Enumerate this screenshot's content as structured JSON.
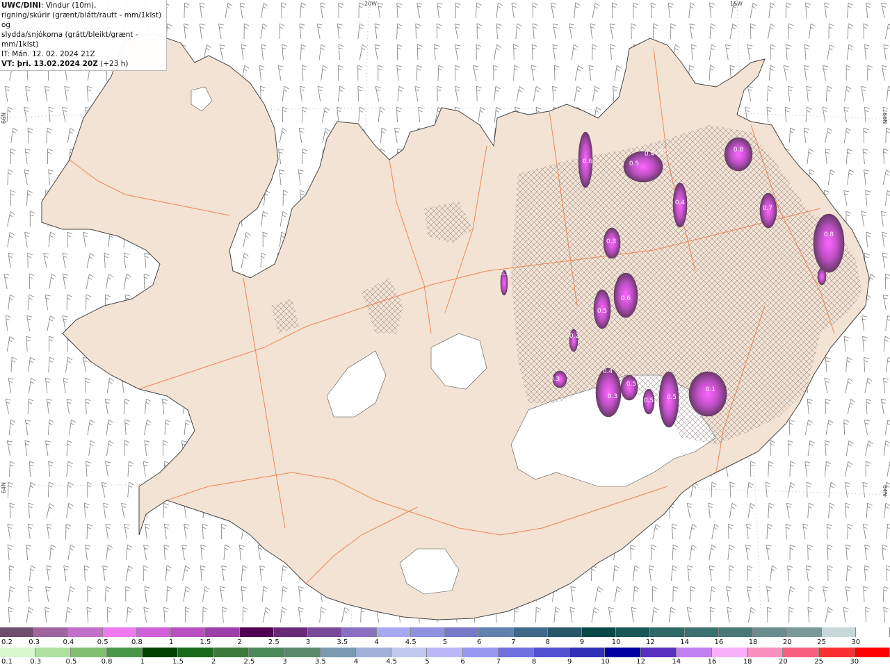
{
  "title": {
    "line1_bold": "UWC/DINI",
    "line1_rest": ": Vindur (10m),",
    "line2": "rigning/skúrir (grænt/blátt/rautt - mm/1klst) og",
    "line3": "slydda/snjókoma (grátt/bleikt/grænt - mm/1klst)",
    "line4": "IT: Mán. 12. 02. 2024 21Z",
    "line5_bold": "VT: þri. 13.02.2024 20Z",
    "line5_rest": " (+23 h)"
  },
  "grid_labels": {
    "lon_20w": "20W",
    "lon_15w": "15W",
    "lat_66n_left": "66N",
    "lat_66n_right": "66N",
    "lat_64n_left": "64N",
    "lat_64n_right": "64N"
  },
  "colors": {
    "land": "#f2e3d4",
    "coast": "#444444",
    "roads": "#ee7744",
    "glacier": "#ffffff",
    "wind_barb": "#8a8a8a",
    "snow_core": "#ff66ff"
  },
  "precip_labels": [
    "0.5",
    "0.4",
    "0.6",
    "0.8",
    "0.5",
    "0.3",
    "0.4",
    "0.7",
    "0.8",
    "0.3",
    "0.5",
    "0.6",
    "0.5",
    "0.2",
    "0.1",
    "0.4",
    "0.3",
    "0.5",
    "0.5",
    "0.5"
  ],
  "legend_snow": {
    "labels": [
      "0.2",
      "0.3",
      "0.4",
      "0.5",
      "0.8",
      "1",
      "1.5",
      "2",
      "2.5",
      "3",
      "3.5",
      "4",
      "4.5",
      "5",
      "6",
      "7",
      "8",
      "9",
      "10",
      "12",
      "14",
      "16",
      "18",
      "20",
      "25",
      "30"
    ],
    "colors": [
      "#6d4e6d",
      "#a065a0",
      "#c070c8",
      "#ee7aee",
      "#d060d8",
      "#b850c0",
      "#9a40a8",
      "#500050",
      "#6a2a7a",
      "#7a4a9a",
      "#8a70c0",
      "#a8a8f0",
      "#9090e0",
      "#7878c8",
      "#6080b0",
      "#406888",
      "#285868",
      "#084848",
      "#1a5858",
      "#306868",
      "#3a7070",
      "#4a7878",
      "#6a8e8e",
      "#7a9a9a",
      "#c8d8d8",
      "#ffffff"
    ]
  },
  "legend_rain": {
    "labels": [
      "0.1",
      "0.3",
      "0.5",
      "0.8",
      "1",
      "1.5",
      "2",
      "2.5",
      "3",
      "3.5",
      "4",
      "4.5",
      "5",
      "6",
      "7",
      "8",
      "9",
      "10",
      "12",
      "14",
      "16",
      "18",
      "20",
      "25",
      "30"
    ],
    "colors": [
      "#d8f8d0",
      "#b0e0a0",
      "#80c070",
      "#489848",
      "#004000",
      "#1a6a1a",
      "#3a7a3a",
      "#4a8a5a",
      "#5a8a6a",
      "#7a9ab0",
      "#a0b0d8",
      "#c0c8f0",
      "#b8b8f8",
      "#9898f0",
      "#7070e0",
      "#5050d0",
      "#3030b8",
      "#0000a0",
      "#5a30c0",
      "#c080f0",
      "#f8b0f8",
      "#f890c0",
      "#f86080",
      "#f83030",
      "#ff0000"
    ]
  }
}
